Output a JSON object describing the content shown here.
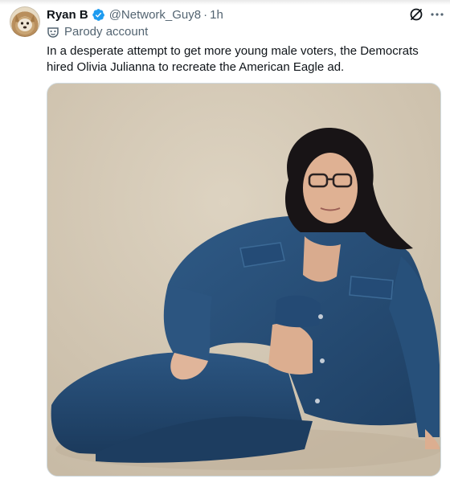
{
  "post": {
    "author_name": "Ryan B",
    "handle": "@Network_Guy8",
    "separator": "·",
    "timestamp": "1h",
    "label": "Parody account",
    "text": "In a desperate attempt to get more young male voters, the Democrats hired Olivia Julianna to recreate the American Eagle ad."
  },
  "icons": {
    "verified": "verified-badge-icon",
    "parody": "mask-icon",
    "grok": "grok-icon",
    "more": "more-icon"
  },
  "colors": {
    "verified": "#1d9bf0",
    "secondary_text": "#536471",
    "primary_text": "#0f1419"
  }
}
